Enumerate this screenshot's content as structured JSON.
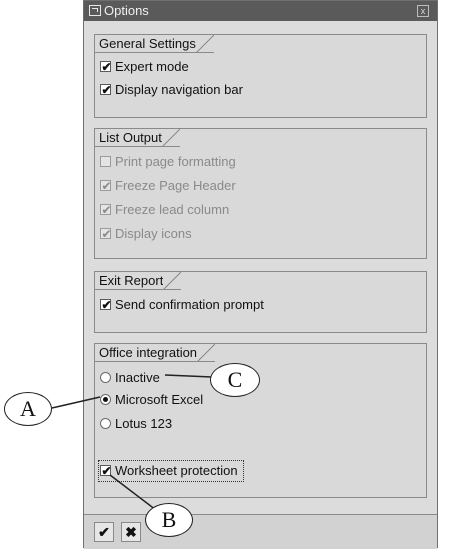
{
  "window": {
    "title": "Options",
    "close_glyph": "x"
  },
  "groups": {
    "general": {
      "title": "General Settings",
      "items": [
        {
          "label": "Expert mode",
          "checked": true,
          "enabled": true
        },
        {
          "label": "Display navigation bar",
          "checked": true,
          "enabled": true
        }
      ]
    },
    "list_output": {
      "title": "List Output",
      "items": [
        {
          "label": "Print page formatting",
          "checked": false,
          "enabled": false
        },
        {
          "label": "Freeze Page Header",
          "checked": true,
          "enabled": false
        },
        {
          "label": "Freeze lead column",
          "checked": true,
          "enabled": false
        },
        {
          "label": "Display icons",
          "checked": true,
          "enabled": false
        }
      ]
    },
    "exit_report": {
      "title": "Exit Report",
      "items": [
        {
          "label": "Send confirmation prompt",
          "checked": true,
          "enabled": true
        }
      ]
    },
    "office": {
      "title": "Office integration",
      "radios": [
        {
          "label": "Inactive",
          "selected": false
        },
        {
          "label": "Microsoft Excel",
          "selected": true
        },
        {
          "label": "Lotus 123",
          "selected": false
        }
      ],
      "worksheet_protection": {
        "label": "Worksheet protection",
        "checked": true
      }
    }
  },
  "footer": {
    "ok_glyph": "✔",
    "cancel_glyph": "✖"
  },
  "callouts": {
    "a": "A",
    "b": "B",
    "c": "C"
  },
  "colors": {
    "titlebar": "#5a5a5a",
    "window_bg": "#dcdcdc",
    "disabled_text": "#8a8a8a"
  },
  "icons": {
    "title": "window-icon",
    "close": "close-icon",
    "ok": "checkmark-icon",
    "cancel": "x-icon"
  }
}
